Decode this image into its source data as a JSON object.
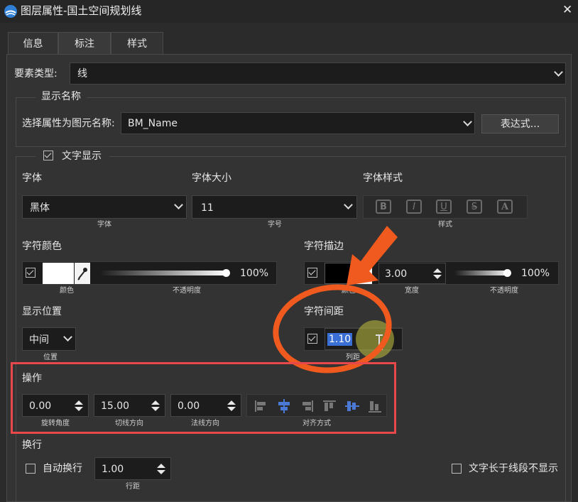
{
  "window": {
    "title": "图层属性-国土空间规划线",
    "close_glyph": "✕"
  },
  "tabs": [
    {
      "label": "信息",
      "active": false
    },
    {
      "label": "标注",
      "active": true
    },
    {
      "label": "样式",
      "active": false
    }
  ],
  "feature_type": {
    "label": "要素类型:",
    "value": "线"
  },
  "display_name": {
    "group_label": "显示名称",
    "select_label": "选择属性为图元名称:",
    "select_value": "BM_Name",
    "expr_button": "表达式..."
  },
  "text_display": {
    "group_label": "文字显示",
    "checked": true,
    "font": {
      "label": "字体",
      "value": "黑体",
      "caption": "字体"
    },
    "font_size": {
      "label": "字体大小",
      "value": "11",
      "caption": "字号"
    },
    "font_style": {
      "label": "字体样式",
      "caption": "样式",
      "buttons": [
        "B",
        "I",
        "U",
        "S",
        "A"
      ]
    },
    "char_color": {
      "label": "字符颜色",
      "checked": true,
      "color": "#ffffff",
      "color_caption": "颜色",
      "opacity_value": "100%",
      "opacity_caption": "不透明度",
      "opacity_fraction": 1.0
    },
    "char_stroke": {
      "label": "字符描边",
      "checked": true,
      "color": "#000000",
      "color_caption": "颜色",
      "width_value": "3.00",
      "width_caption": "宽度",
      "opacity_value": "100%",
      "opacity_caption": "不透明度",
      "opacity_fraction": 1.0
    },
    "position": {
      "label": "显示位置",
      "value": "中间",
      "caption": "位置"
    },
    "spacing": {
      "label": "字符间距",
      "checked": true,
      "value": "1.10",
      "caption": "列距"
    }
  },
  "operation": {
    "label": "操作",
    "rotation": {
      "value": "0.00",
      "caption": "旋转角度"
    },
    "tangent": {
      "value": "15.00",
      "caption": "切线方向"
    },
    "normal": {
      "value": "0.00",
      "caption": "法线方向"
    },
    "align_caption": "对齐方式",
    "align_icons": [
      "align-top-left-icon",
      "align-center-h-icon",
      "align-top-right-icon",
      "align-top-icon",
      "align-middle-v-icon",
      "align-bottom-icon"
    ]
  },
  "wrap": {
    "label": "换行",
    "auto_wrap": {
      "label": "自动换行",
      "checked": false
    },
    "line_spacing": {
      "value": "1.00",
      "caption": "行距"
    },
    "hide_long": {
      "label": "文字长于线段不显示",
      "checked": false
    }
  },
  "colors": {
    "accent_blue": "#4a7ad6",
    "annotation_orange": "#f05a1e",
    "highlight_red": "#e8484a"
  }
}
